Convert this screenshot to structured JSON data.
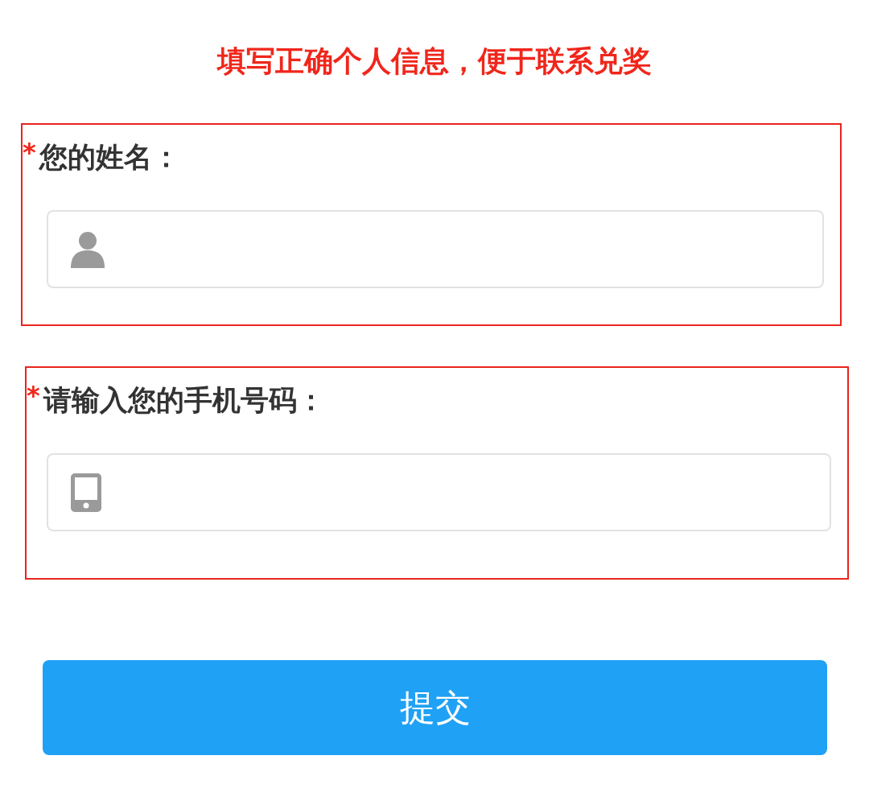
{
  "title": "填写正确个人信息，便于联系兑奖",
  "fields": [
    {
      "kind": "person",
      "required": true,
      "required_mark": "*",
      "label": "您的姓名："
    },
    {
      "kind": "phone",
      "required": true,
      "required_mark": "*",
      "label": "请输入您的手机号码："
    }
  ],
  "submit_button": "提交"
}
